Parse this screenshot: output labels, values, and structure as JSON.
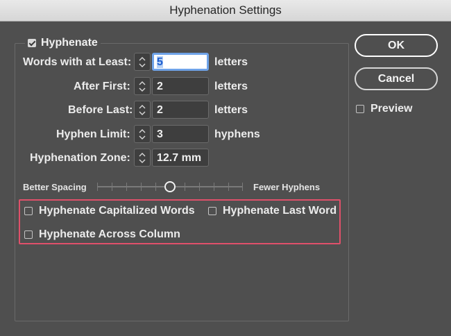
{
  "window": {
    "title": "Hyphenation Settings"
  },
  "hyphenate": {
    "label": "Hyphenate",
    "checked": true
  },
  "fields": [
    {
      "label": "Words with at Least:",
      "value": "5",
      "unit": "letters"
    },
    {
      "label": "After First:",
      "value": "2",
      "unit": "letters"
    },
    {
      "label": "Before Last:",
      "value": "2",
      "unit": "letters"
    },
    {
      "label": "Hyphen Limit:",
      "value": "3",
      "unit": "hyphens"
    },
    {
      "label": "Hyphenation Zone:",
      "value": "12.7 mm",
      "unit": ""
    }
  ],
  "slider": {
    "left_label": "Better Spacing",
    "right_label": "Fewer Hyphens",
    "position": 0.5
  },
  "options": {
    "capitalized": "Hyphenate Capitalized Words",
    "last_word": "Hyphenate Last Word",
    "across_column": "Hyphenate Across Column"
  },
  "buttons": {
    "ok": "OK",
    "cancel": "Cancel"
  },
  "preview": {
    "label": "Preview",
    "checked": false
  }
}
